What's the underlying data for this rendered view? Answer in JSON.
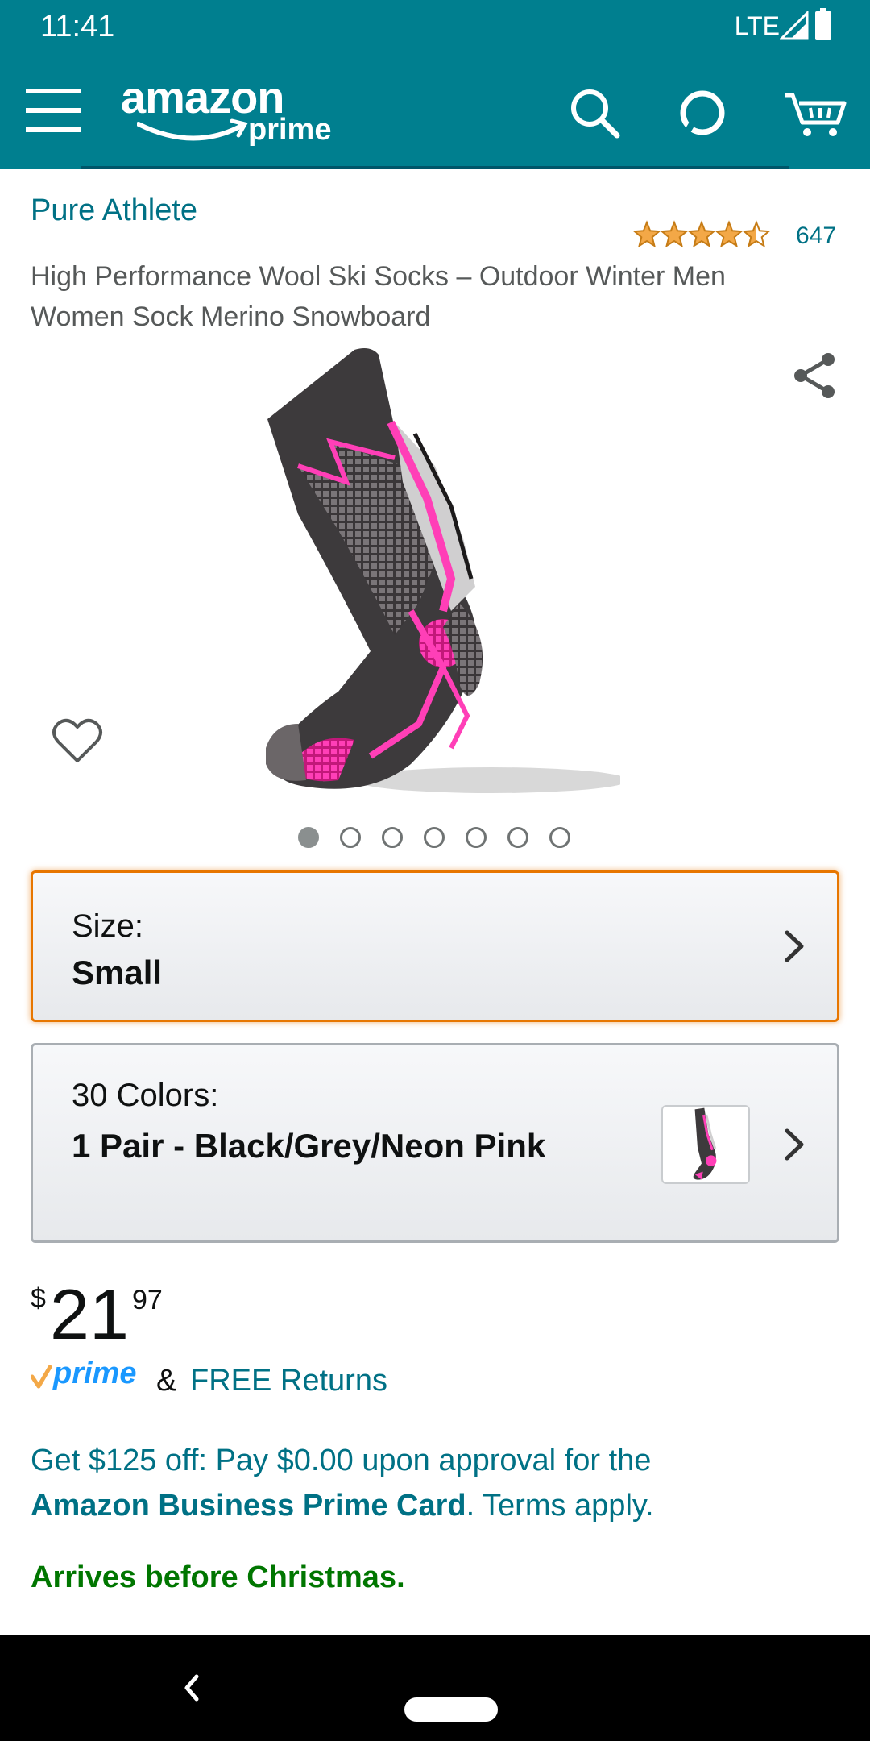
{
  "status_bar": {
    "time": "11:41",
    "network": "LTE"
  },
  "header": {
    "logo_text": "amazon",
    "logo_sub": "prime",
    "accent": "#007f8f"
  },
  "product": {
    "brand": "Pure Athlete",
    "rating_stars": 4.5,
    "rating_count": "647",
    "title": "High Performance Wool Ski Socks – Outdoor Winter Men Women Sock Merino Snowboard",
    "image_count": 7,
    "active_image": 1
  },
  "size": {
    "label": "Size:",
    "value": "Small"
  },
  "color": {
    "label": "30 Colors:",
    "value": "1 Pair - Black/Grey/Neon Pink"
  },
  "price": {
    "symbol": "$",
    "whole": "21",
    "fraction": "97"
  },
  "shipping": {
    "prime_label": "prime",
    "amp": "&",
    "free_returns": "FREE Returns"
  },
  "promo": {
    "line_part1": "Get $125 off: Pay $0.00 upon approval for the",
    "card_name": "Amazon Business Prime Card",
    "line_part2": ". Terms apply."
  },
  "delivery": {
    "message": "Arrives before Christmas.",
    "color": "#007600"
  },
  "icons": [
    "menu-icon",
    "search-icon",
    "alexa-icon",
    "cart-icon",
    "share-icon",
    "heart-icon",
    "chevron-right-icon",
    "back-icon"
  ]
}
